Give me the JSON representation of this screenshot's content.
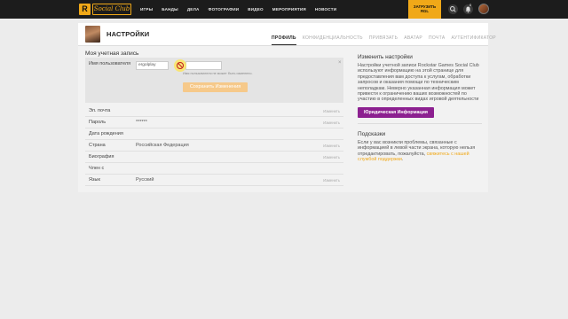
{
  "topbar": {
    "logo_r": "R",
    "logo_text": "Social Club",
    "nav": [
      "ИГРЫ",
      "БАНДЫ",
      "ДЕЛА",
      "ФОТОГРАФИИ",
      "ВИДЕО",
      "МЕРОПРИЯТИЯ",
      "НОВОСТИ"
    ],
    "download_line1": "ЗАГРУЗИТЬ",
    "download_line2": "RGL",
    "notif_count": "0"
  },
  "header": {
    "title": "НАСТРОЙКИ",
    "tabs": [
      "ПРОФИЛЬ",
      "КОНФИДЕНЦИАЛЬНОСТЬ",
      "ПРИВЯЗАТЬ",
      "АВАТАР",
      "ПОЧТА",
      "АУТЕНТИФИКАТОР"
    ]
  },
  "account": {
    "section_title": "Моя учетная запись",
    "edit": {
      "label": "Имя пользователя",
      "value": "ergolplay",
      "hint": "Имя пользователя не может быть изменено.",
      "close": "×",
      "save_label": "Сохранить Изменения"
    },
    "rows": [
      {
        "label": "Эл. почта",
        "value": "",
        "edit": "Изменить"
      },
      {
        "label": "Пароль",
        "value": "******",
        "edit": "Изменить"
      },
      {
        "label": "Дата рождения",
        "value": "",
        "edit": ""
      },
      {
        "label": "Страна",
        "value": "Российская Федерация",
        "edit": "Изменить"
      },
      {
        "label": "Биография",
        "value": "",
        "edit": "Изменить"
      },
      {
        "label": "Член с",
        "value": "",
        "edit": ""
      },
      {
        "label": "Язык",
        "value": "Русский",
        "edit": "Изменить"
      }
    ]
  },
  "sidebar": {
    "change_title": "Изменить настройки",
    "change_text": "Настройки учетной записи Rockstar Games Social Club используют информацию на этой странице для предоставления вам доступа к услугам, обработки запросов и оказания помощи по техническим неполадкам. Неверно указанная информация может привести к ограничению ваших возможностей по участию в определенных видах игровой деятельности",
    "legal_btn": "Юридическая Информация",
    "hints_title": "Подсказки",
    "hints_text": "Если у вас возникли проблемы, связанные с информацией в левой части экрана, которую нельзя отредактировать, пожалуйста,",
    "hints_link": "свяжитесь с нашей службой поддержки",
    "hints_end": "."
  },
  "colors": {
    "accent": "#f0a818",
    "legal": "#8c2090",
    "topbar": "#1c1c1c"
  }
}
